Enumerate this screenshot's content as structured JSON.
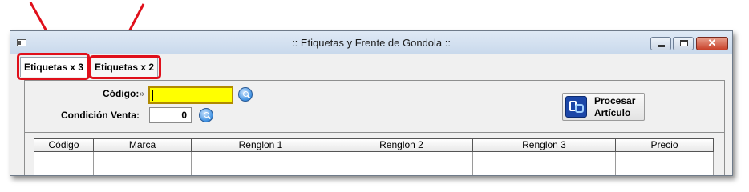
{
  "window": {
    "title": ":: Etiquetas y Frente de Gondola ::"
  },
  "tabs": [
    {
      "label": "Etiquetas x 3",
      "active": true
    },
    {
      "label": "Etiquetas x 2",
      "active": false
    }
  ],
  "form": {
    "codigo_label": "Código:",
    "codigo_value": "",
    "condicion_label": "Condición Venta:",
    "condicion_value": "0"
  },
  "process_button": {
    "line1": "Procesar",
    "line2": "Artículo"
  },
  "table": {
    "columns": [
      "Código",
      "Marca",
      "Renglon 1",
      "Renglon 2",
      "Renglon 3",
      "Precio"
    ]
  },
  "colors": {
    "highlight": "#e0101b",
    "input_focus": "#ffff00"
  },
  "icons": [
    "window-app-icon",
    "minimize-icon",
    "maximize-icon",
    "close-icon",
    "search-icon",
    "process-article-icon",
    "red-arrow-icon"
  ]
}
